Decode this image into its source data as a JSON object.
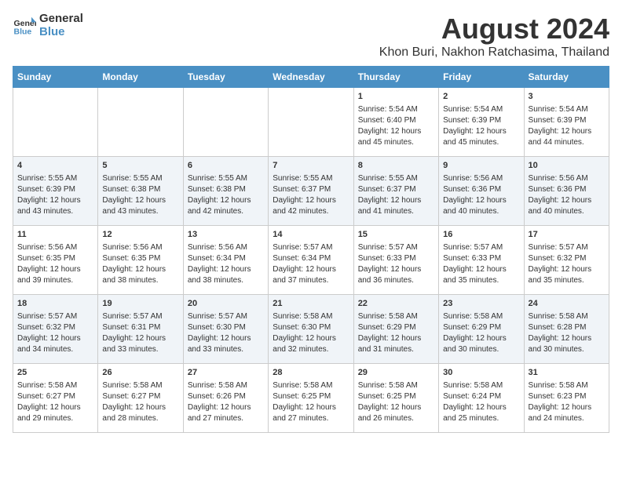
{
  "header": {
    "logo_line1": "General",
    "logo_line2": "Blue",
    "title": "August 2024",
    "subtitle": "Khon Buri, Nakhon Ratchasima, Thailand"
  },
  "days_of_week": [
    "Sunday",
    "Monday",
    "Tuesday",
    "Wednesday",
    "Thursday",
    "Friday",
    "Saturday"
  ],
  "weeks": [
    [
      {
        "day": "",
        "text": ""
      },
      {
        "day": "",
        "text": ""
      },
      {
        "day": "",
        "text": ""
      },
      {
        "day": "",
        "text": ""
      },
      {
        "day": "1",
        "text": "Sunrise: 5:54 AM\nSunset: 6:40 PM\nDaylight: 12 hours\nand 45 minutes."
      },
      {
        "day": "2",
        "text": "Sunrise: 5:54 AM\nSunset: 6:39 PM\nDaylight: 12 hours\nand 45 minutes."
      },
      {
        "day": "3",
        "text": "Sunrise: 5:54 AM\nSunset: 6:39 PM\nDaylight: 12 hours\nand 44 minutes."
      }
    ],
    [
      {
        "day": "4",
        "text": "Sunrise: 5:55 AM\nSunset: 6:39 PM\nDaylight: 12 hours\nand 43 minutes."
      },
      {
        "day": "5",
        "text": "Sunrise: 5:55 AM\nSunset: 6:38 PM\nDaylight: 12 hours\nand 43 minutes."
      },
      {
        "day": "6",
        "text": "Sunrise: 5:55 AM\nSunset: 6:38 PM\nDaylight: 12 hours\nand 42 minutes."
      },
      {
        "day": "7",
        "text": "Sunrise: 5:55 AM\nSunset: 6:37 PM\nDaylight: 12 hours\nand 42 minutes."
      },
      {
        "day": "8",
        "text": "Sunrise: 5:55 AM\nSunset: 6:37 PM\nDaylight: 12 hours\nand 41 minutes."
      },
      {
        "day": "9",
        "text": "Sunrise: 5:56 AM\nSunset: 6:36 PM\nDaylight: 12 hours\nand 40 minutes."
      },
      {
        "day": "10",
        "text": "Sunrise: 5:56 AM\nSunset: 6:36 PM\nDaylight: 12 hours\nand 40 minutes."
      }
    ],
    [
      {
        "day": "11",
        "text": "Sunrise: 5:56 AM\nSunset: 6:35 PM\nDaylight: 12 hours\nand 39 minutes."
      },
      {
        "day": "12",
        "text": "Sunrise: 5:56 AM\nSunset: 6:35 PM\nDaylight: 12 hours\nand 38 minutes."
      },
      {
        "day": "13",
        "text": "Sunrise: 5:56 AM\nSunset: 6:34 PM\nDaylight: 12 hours\nand 38 minutes."
      },
      {
        "day": "14",
        "text": "Sunrise: 5:57 AM\nSunset: 6:34 PM\nDaylight: 12 hours\nand 37 minutes."
      },
      {
        "day": "15",
        "text": "Sunrise: 5:57 AM\nSunset: 6:33 PM\nDaylight: 12 hours\nand 36 minutes."
      },
      {
        "day": "16",
        "text": "Sunrise: 5:57 AM\nSunset: 6:33 PM\nDaylight: 12 hours\nand 35 minutes."
      },
      {
        "day": "17",
        "text": "Sunrise: 5:57 AM\nSunset: 6:32 PM\nDaylight: 12 hours\nand 35 minutes."
      }
    ],
    [
      {
        "day": "18",
        "text": "Sunrise: 5:57 AM\nSunset: 6:32 PM\nDaylight: 12 hours\nand 34 minutes."
      },
      {
        "day": "19",
        "text": "Sunrise: 5:57 AM\nSunset: 6:31 PM\nDaylight: 12 hours\nand 33 minutes."
      },
      {
        "day": "20",
        "text": "Sunrise: 5:57 AM\nSunset: 6:30 PM\nDaylight: 12 hours\nand 33 minutes."
      },
      {
        "day": "21",
        "text": "Sunrise: 5:58 AM\nSunset: 6:30 PM\nDaylight: 12 hours\nand 32 minutes."
      },
      {
        "day": "22",
        "text": "Sunrise: 5:58 AM\nSunset: 6:29 PM\nDaylight: 12 hours\nand 31 minutes."
      },
      {
        "day": "23",
        "text": "Sunrise: 5:58 AM\nSunset: 6:29 PM\nDaylight: 12 hours\nand 30 minutes."
      },
      {
        "day": "24",
        "text": "Sunrise: 5:58 AM\nSunset: 6:28 PM\nDaylight: 12 hours\nand 30 minutes."
      }
    ],
    [
      {
        "day": "25",
        "text": "Sunrise: 5:58 AM\nSunset: 6:27 PM\nDaylight: 12 hours\nand 29 minutes."
      },
      {
        "day": "26",
        "text": "Sunrise: 5:58 AM\nSunset: 6:27 PM\nDaylight: 12 hours\nand 28 minutes."
      },
      {
        "day": "27",
        "text": "Sunrise: 5:58 AM\nSunset: 6:26 PM\nDaylight: 12 hours\nand 27 minutes."
      },
      {
        "day": "28",
        "text": "Sunrise: 5:58 AM\nSunset: 6:25 PM\nDaylight: 12 hours\nand 27 minutes."
      },
      {
        "day": "29",
        "text": "Sunrise: 5:58 AM\nSunset: 6:25 PM\nDaylight: 12 hours\nand 26 minutes."
      },
      {
        "day": "30",
        "text": "Sunrise: 5:58 AM\nSunset: 6:24 PM\nDaylight: 12 hours\nand 25 minutes."
      },
      {
        "day": "31",
        "text": "Sunrise: 5:58 AM\nSunset: 6:23 PM\nDaylight: 12 hours\nand 24 minutes."
      }
    ]
  ]
}
